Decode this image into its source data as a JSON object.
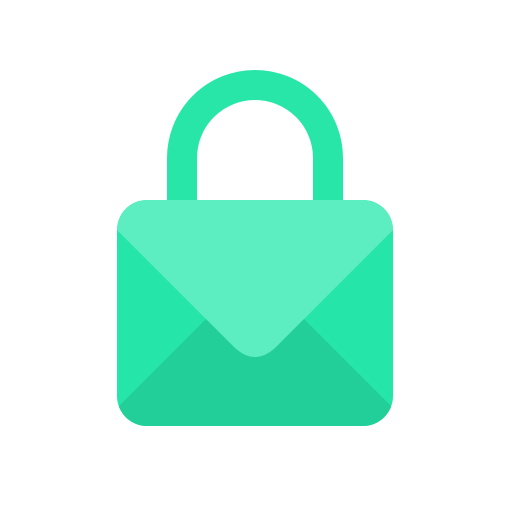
{
  "icon": {
    "name": "locked-mail-icon",
    "colors": {
      "background": "#ffffff",
      "shackle": "#27e6a8",
      "envelope_body": "#25e5a8",
      "envelope_bottom": "#22cf98",
      "envelope_flap": "#5cedc1"
    }
  }
}
